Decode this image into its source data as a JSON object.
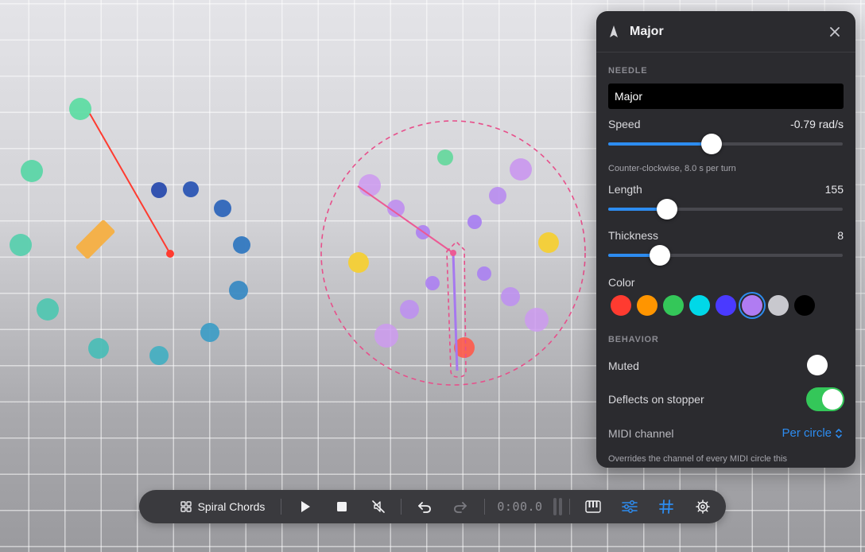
{
  "panel": {
    "title": "Major",
    "needle_section": "NEEDLE",
    "name_value": "Major",
    "speed": {
      "label": "Speed",
      "value": "-0.79 rad/s",
      "level": 0.44,
      "hint": "Counter-clockwise, 8.0 s per turn"
    },
    "length": {
      "label": "Length",
      "value": "155",
      "level": 0.25
    },
    "thickness": {
      "label": "Thickness",
      "value": "8",
      "level": 0.22
    },
    "color_label": "Color",
    "colors": [
      "#ff3b30",
      "#ff9500",
      "#34c759",
      "#00d8e8",
      "#4a3aff",
      "#b07cf2",
      "#c8c8ce",
      "#000000"
    ],
    "selected_color": "#b07cf2",
    "behavior_section": "BEHAVIOR",
    "muted": {
      "label": "Muted",
      "on": false
    },
    "deflects": {
      "label": "Deflects on stopper",
      "on": true
    },
    "midi": {
      "label": "MIDI channel",
      "value": "Per circle",
      "hint": "Overrides the channel of every MIDI circle this"
    }
  },
  "toolbar": {
    "project_name": "Spiral Chords",
    "time": "0:00.0",
    "icons": [
      "grid-icon",
      "play-icon",
      "stop-icon",
      "mute-icon",
      "undo-icon",
      "redo-icon",
      "piano-icon",
      "sliders-icon",
      "hashtag-icon",
      "gear-icon"
    ]
  },
  "colors": {
    "accent": "#2d8cf0",
    "panel_bg": "#2b2b2f",
    "toggle_on": "#34c759",
    "needle_red": "#ff3b30",
    "stopper": "#f4b14a"
  }
}
